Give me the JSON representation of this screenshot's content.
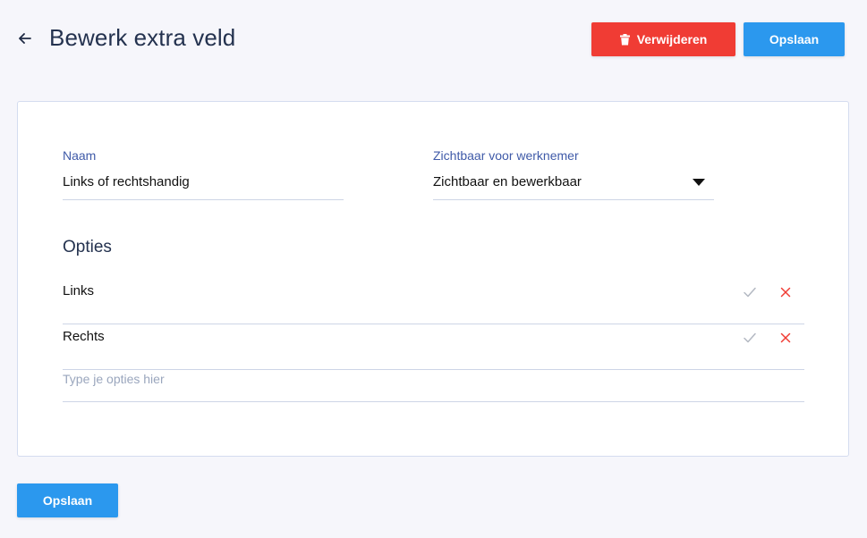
{
  "header": {
    "title": "Bewerk extra veld",
    "back_icon": "arrow-left-icon",
    "delete_label": "Verwijderen",
    "delete_icon": "trash-icon",
    "save_label": "Opslaan"
  },
  "form": {
    "name_label": "Naam",
    "name_value": "Links of rechtshandig",
    "visibility_label": "Zichtbaar voor werknemer",
    "visibility_value": "Zichtbaar en bewerkbaar",
    "options_title": "Opties",
    "options": [
      {
        "label": "Links"
      },
      {
        "label": "Rechts"
      }
    ],
    "new_option_placeholder": "Type je opties hier"
  },
  "footer": {
    "save_label": "Opslaan"
  },
  "colors": {
    "danger": "#f03c34",
    "primary": "#2b98ee",
    "label": "#3f5aa8"
  }
}
